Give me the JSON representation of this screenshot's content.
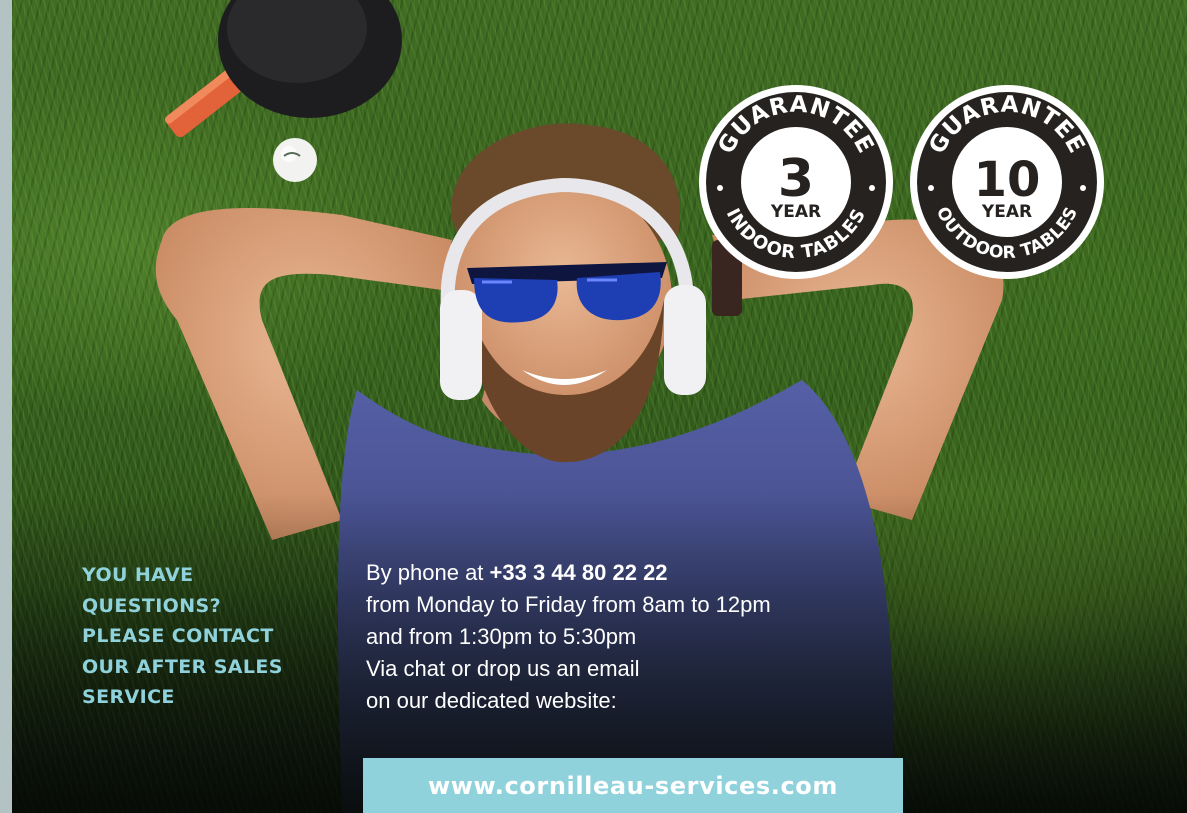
{
  "badges": [
    {
      "top_text": "GUARANTEE",
      "number": "3",
      "unit": "YEAR",
      "bottom_text": "INDOOR TABLES"
    },
    {
      "top_text": "GUARANTEE",
      "number": "10",
      "unit": "YEAR",
      "bottom_text": "OUTDOOR TABLES"
    }
  ],
  "contact": {
    "heading_lines": [
      "YOU HAVE",
      "QUESTIONS?",
      "PLEASE CONTACT",
      "OUR AFTER SALES",
      "SERVICE"
    ],
    "phone_prefix": "By phone at ",
    "phone_number": "+33 3 44 80 22 22",
    "lines": [
      "from Monday to Friday from 8am to 12pm",
      "and from 1:30pm to 5:30pm",
      "Via chat or drop us an email",
      "on our dedicated website:"
    ],
    "website": "www.cornilleau-services.com"
  },
  "colors": {
    "accent": "#8fd2dc",
    "left_strip": "#b3c3c4",
    "badge_dark": "#262220",
    "text_light": "#ffffff"
  }
}
